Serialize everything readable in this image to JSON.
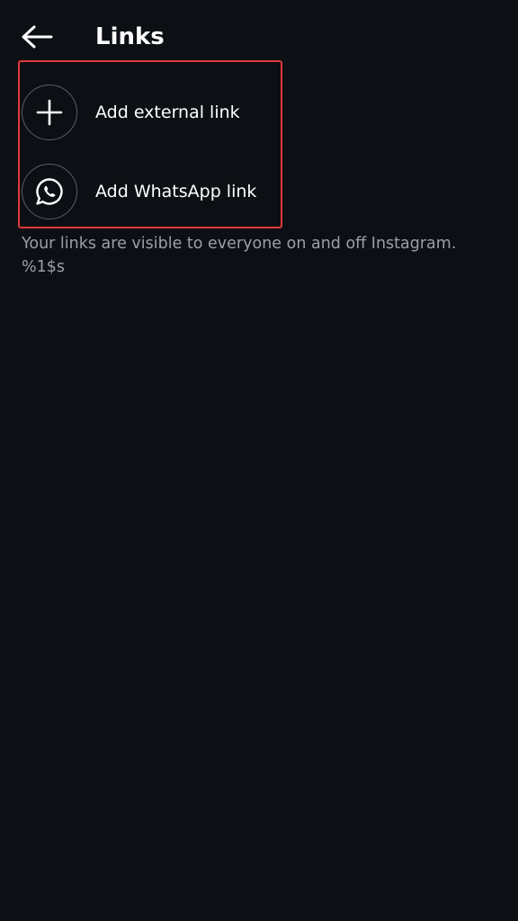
{
  "header": {
    "title": "Links",
    "back_icon": "back-arrow-icon"
  },
  "links": {
    "items": [
      {
        "label": "Add external link",
        "icon": "plus-icon"
      },
      {
        "label": "Add WhatsApp link",
        "icon": "whatsapp-icon"
      }
    ]
  },
  "footnote": {
    "line1": "Your links are visible to everyone on and off Instagram.",
    "line2": "%1$s"
  },
  "colors": {
    "background": "#0c0f14",
    "text_primary": "#ffffff",
    "text_secondary": "#9aa0a8",
    "highlight_border": "#e0393b",
    "icon_circle_border": "#5b5f66"
  }
}
